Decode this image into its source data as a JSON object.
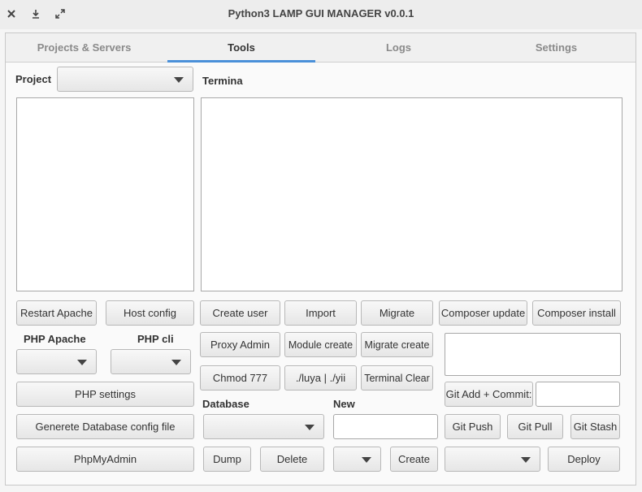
{
  "window": {
    "title": "Python3 LAMP GUI MANAGER v0.0.1"
  },
  "tabs": [
    {
      "label": "Projects & Servers",
      "active": false
    },
    {
      "label": "Tools",
      "active": true
    },
    {
      "label": "Logs",
      "active": false
    },
    {
      "label": "Settings",
      "active": false
    }
  ],
  "left": {
    "project_label": "Project",
    "project_value": "",
    "restart_apache": "Restart Apache",
    "host_config": "Host config",
    "php_apache_label": "PHP Apache",
    "php_cli_label": "PHP cli",
    "php_settings": "PHP settings",
    "generate_db_config": "Generete Database config file",
    "phpmyadmin": "PhpMyAdmin"
  },
  "terminal": {
    "label": "Termina"
  },
  "tools": {
    "create_user": "Create user",
    "import": "Import",
    "migrate": "Migrate",
    "composer_update": "Composer update",
    "composer_install": "Composer install",
    "proxy_admin": "Proxy Admin",
    "module_create": "Module create",
    "migrate_create": "Migrate create",
    "chmod": "Chmod 777",
    "luya_yii": "./luya | ./yii",
    "terminal_clear": "Terminal Clear"
  },
  "database": {
    "label": "Database",
    "new_label": "New",
    "new_value": "",
    "dump": "Dump",
    "delete": "Delete",
    "create": "Create"
  },
  "git": {
    "add_commit": "Git Add + Commit:",
    "commit_message": "",
    "push": "Git Push",
    "pull": "Git Pull",
    "stash": "Git Stash",
    "deploy": "Deploy"
  },
  "colors": {
    "tab_underline": "#4a90d9"
  },
  "icons": [
    "close-icon",
    "minimize-icon",
    "maximize-icon",
    "chevron-down-icon"
  ]
}
